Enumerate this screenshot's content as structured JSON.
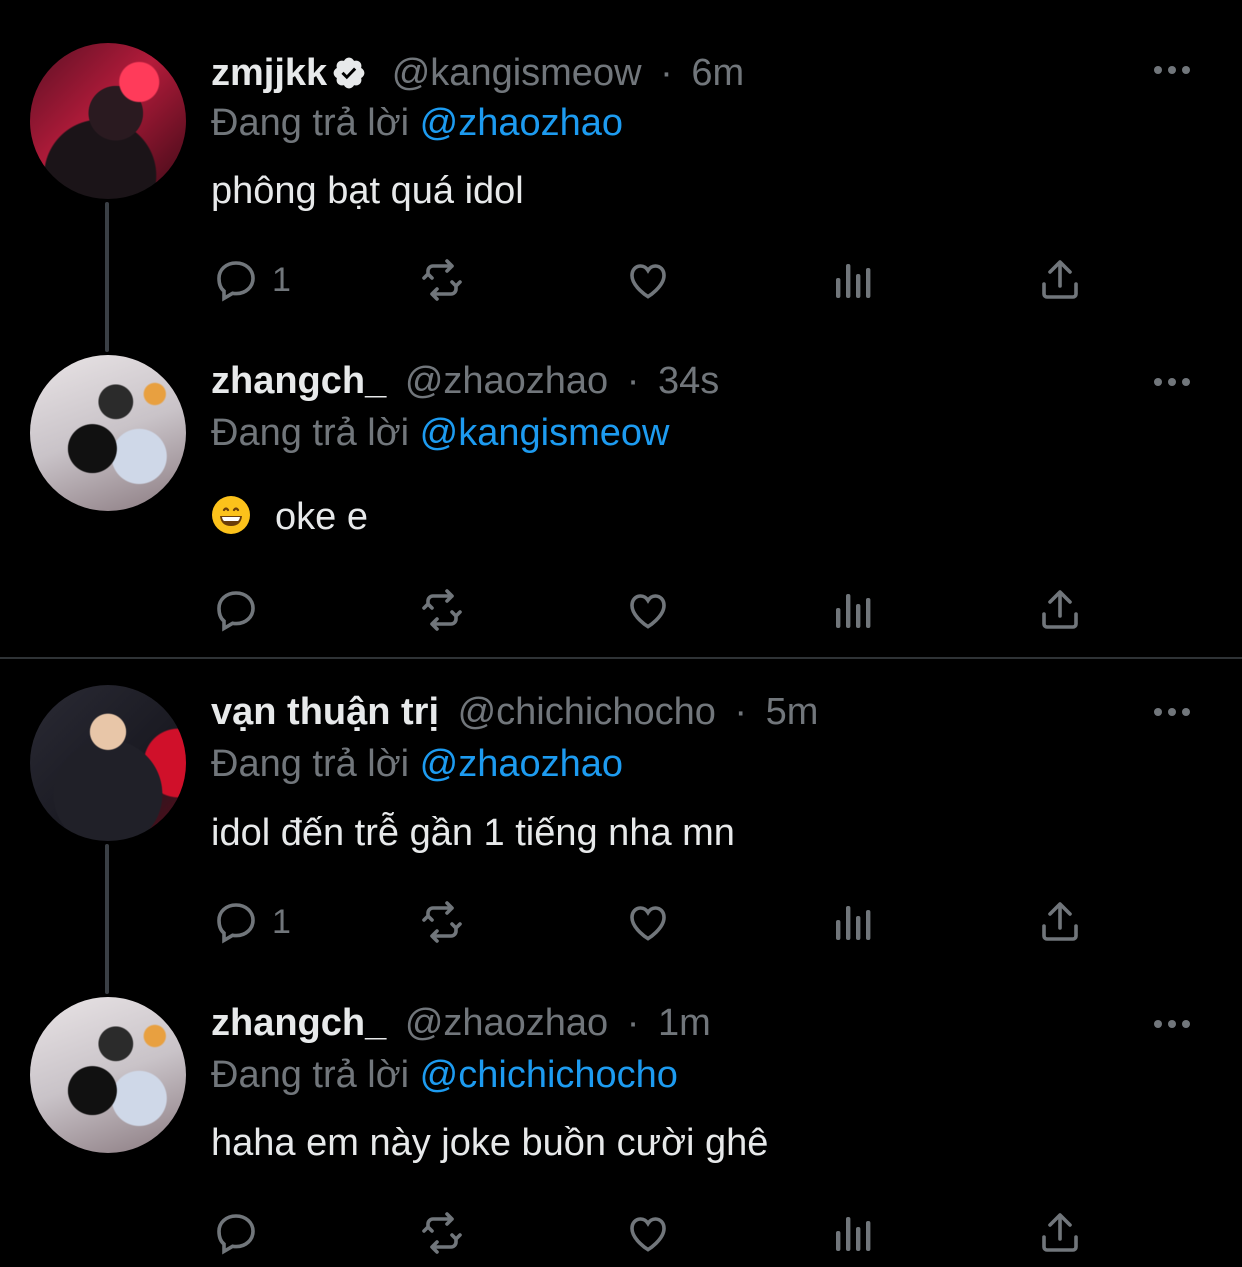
{
  "tweets": [
    {
      "name": "zmjjkk",
      "verified": true,
      "handle": "@kangismeow",
      "sep": "·",
      "time": "6m",
      "reply_prefix": "Đang trả lời",
      "reply_to": "@zhaozhao",
      "text": "phông bạt quá idol",
      "has_emoji": false,
      "reply_count": "1"
    },
    {
      "name": "zhangch_",
      "verified": false,
      "handle": "@zhaozhao",
      "sep": "·",
      "time": "34s",
      "reply_prefix": "Đang trả lời",
      "reply_to": "@kangismeow",
      "text": "oke e",
      "has_emoji": true,
      "emoji": "grinning-face-emoji",
      "reply_count": ""
    },
    {
      "name": "vạn thuận trị",
      "verified": false,
      "handle": "@chichichocho",
      "sep": "·",
      "time": "5m",
      "reply_prefix": "Đang trả lời",
      "reply_to": "@zhaozhao",
      "text": "idol đến trễ gần 1 tiếng nha mn",
      "has_emoji": false,
      "reply_count": "1"
    },
    {
      "name": "zhangch_",
      "verified": false,
      "handle": "@zhaozhao",
      "sep": "·",
      "time": "1m",
      "reply_prefix": "Đang trả lời",
      "reply_to": "@chichichocho",
      "text": "haha em này joke buồn cười ghê",
      "has_emoji": false,
      "reply_count": ""
    }
  ],
  "icons": {
    "reply": "reply-icon",
    "retweet": "retweet-icon",
    "like": "like-icon",
    "views": "views-icon",
    "share": "share-icon",
    "more": "more-icon",
    "verified": "verified-badge-icon"
  },
  "colors": {
    "background": "#000000",
    "text": "#e7e9ea",
    "muted": "#71767b",
    "mention": "#1d9bf0",
    "divider": "#2f3336"
  }
}
